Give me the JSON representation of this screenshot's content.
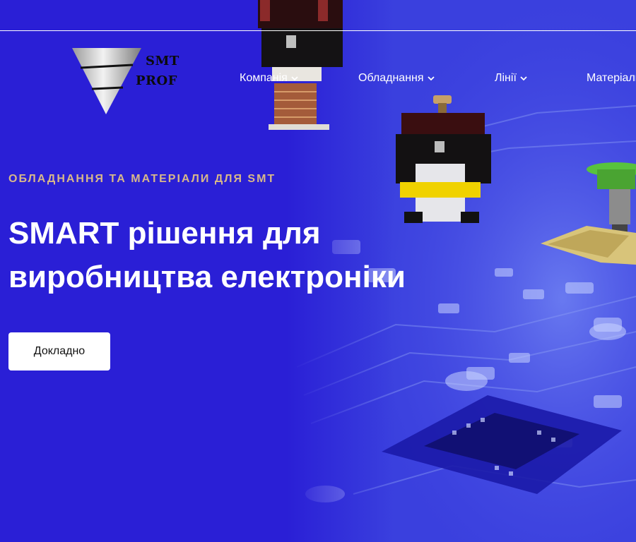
{
  "logo": {
    "line1": "SMT",
    "line2": "PROF"
  },
  "nav": {
    "items": [
      {
        "label": "Компанія"
      },
      {
        "label": "Обладнання"
      },
      {
        "label": "Лінії"
      },
      {
        "label": "Матеріали"
      }
    ]
  },
  "hero": {
    "eyebrow": "ОБЛАДНАННЯ ТА МАТЕРІАЛИ ДЛЯ SMT",
    "headline": "SMART рішення для виробництва електроніки",
    "cta_label": "Докладно"
  },
  "colors": {
    "background": "#2a1fd6",
    "eyebrow": "#d8b88a",
    "cta_bg": "#ffffff",
    "text": "#ffffff"
  }
}
